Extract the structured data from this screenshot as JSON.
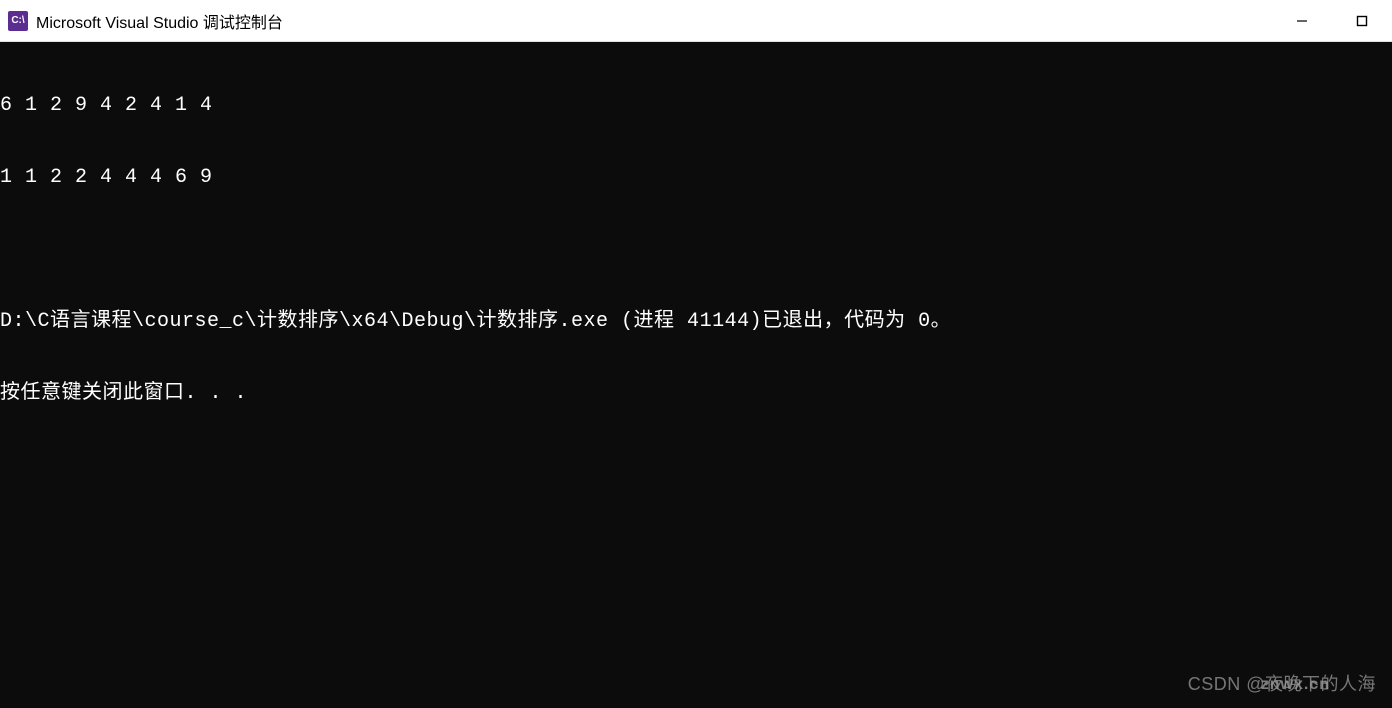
{
  "titlebar": {
    "icon_label": "C:\\",
    "title": "Microsoft Visual Studio 调试控制台"
  },
  "console": {
    "line1": "6 1 2 9 4 2 4 1 4",
    "line2": "1 1 2 2 4 4 4 6 9",
    "line3": "D:\\C语言课程\\course_c\\计数排序\\x64\\Debug\\计数排序.exe (进程 41144)已退出，代码为 0。",
    "line4": "按任意键关闭此窗口. . ."
  },
  "watermark": {
    "text1": "CSDN @夜晚下的人海",
    "text2": "znwx.cn"
  }
}
